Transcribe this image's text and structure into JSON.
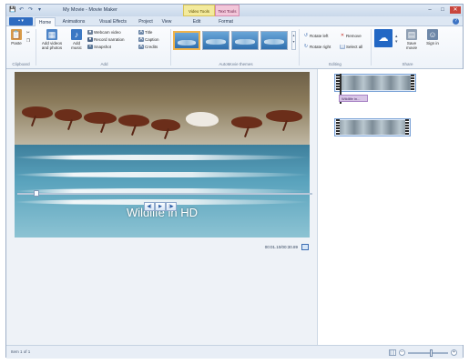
{
  "window": {
    "title": "My Movie - Movie Maker",
    "context_tabs": {
      "video_tools": "Video Tools",
      "text_tools": "Text Tools"
    },
    "controls": {
      "minimize": "–",
      "maximize": "□",
      "close": "✕"
    }
  },
  "quick_access": {
    "save": "💾",
    "undo": "↶",
    "redo": "↷",
    "more": "▾"
  },
  "tabs": {
    "file": "▪ ▾",
    "items": [
      "Home",
      "Animations",
      "Visual Effects",
      "Project",
      "View",
      "Edit",
      "Format"
    ],
    "active": "Home",
    "help": "?"
  },
  "ribbon": {
    "clipboard": {
      "paste": "Paste",
      "label": "Clipboard"
    },
    "add": {
      "add_videos": "Add videos and photos",
      "add_music": "Add music",
      "webcam": "Webcam video",
      "narration": "Record narration",
      "snapshot": "Snapshot",
      "title": "Title",
      "caption": "Caption",
      "credits": "Credits",
      "label": "Add"
    },
    "autothemes": {
      "label": "AutoMovie themes"
    },
    "editing": {
      "rotate_left": "Rotate left",
      "rotate_right": "Rotate right",
      "remove": "Remove",
      "select_all": "Select all",
      "label": "Editing"
    },
    "share": {
      "save_movie": "Save movie",
      "sign_in": "Sign in",
      "label": "Share"
    }
  },
  "preview": {
    "caption_text": "Wildlife in HD",
    "timecode": "00:01.10/00:30.89"
  },
  "transport": {
    "prev": "◀|",
    "play": "▶",
    "next": "|▶"
  },
  "storyboard": {
    "clip_caption": "Wildlife in..."
  },
  "status": {
    "item": "Item 1 of 1",
    "zoom_out": "−",
    "zoom_in": "+"
  }
}
